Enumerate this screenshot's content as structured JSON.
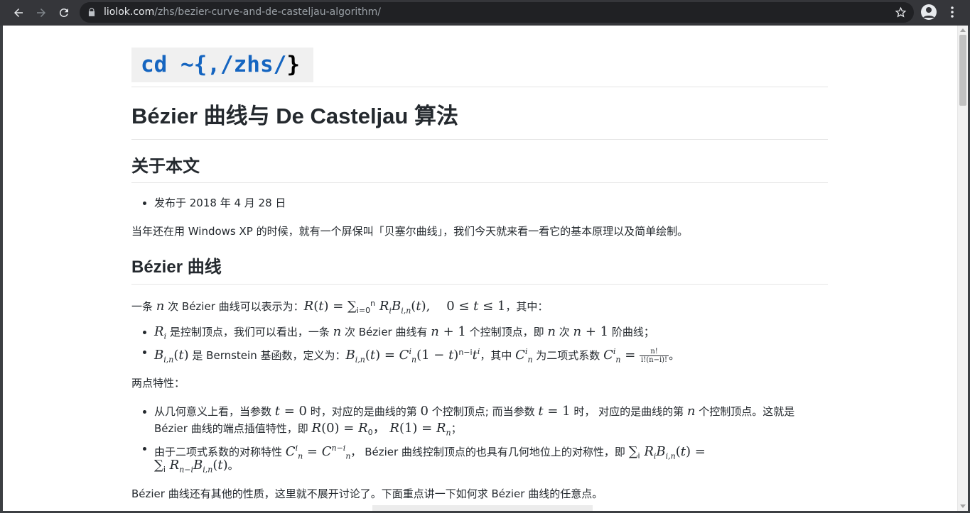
{
  "browser": {
    "url_host": "liolok.com",
    "url_path": "/zhs/bezier-curve-and-de-casteljau-algorithm/",
    "icons": [
      "back-arrow-icon",
      "forward-arrow-icon",
      "reload-icon",
      "lock-icon",
      "star-icon",
      "profile-icon",
      "menu-dots-icon"
    ]
  },
  "site": {
    "logo_cd": "cd ~{,",
    "logo_path": "/zhs/",
    "logo_end": "}"
  },
  "article": {
    "title": "Bézier 曲线与 De Casteljau 算法",
    "about_heading": "关于本文",
    "published": "发布于 2018 年 4 月 28 日",
    "intro": "当年还在用 Windows XP 的时候，就有一个屏保叫「贝塞尔曲线」，我们今天就来看一看它的基本原理以及简单绘制。",
    "bezier_heading": "Bézier 曲线",
    "def_prefix": "一条 ",
    "def_mid": " 次 Bézier 曲线可以表示为：",
    "def_suffix": "，其中：",
    "li1_a": " 是控制顶点，我们可以看出，一条 ",
    "li1_b": " 次 Bézier 曲线有 ",
    "li1_c": " 个控制顶点，即 ",
    "li1_d": " 次 ",
    "li1_e": " 阶曲线；",
    "li2_a": " 是 Bernstein 基函数，定义为：",
    "li2_b": "，其中 ",
    "li2_c": " 为二项式系数 ",
    "li2_end": "。",
    "two_points": "两点特性：",
    "li3_a": "从几何意义上看，当参数 ",
    "li3_b": " 时，对应的是曲线的第 ",
    "li3_c": " 个控制顶点; 而当参数 ",
    "li3_d": " 时， 对应的是曲线的第 ",
    "li3_e": " 个控制顶点。这就是",
    "li3_f": "Bézier 曲线的端点插值特性，即 ",
    "li3_g": "；",
    "li4_a": "由于二项式系数的对称特性 ",
    "li4_b": "， Bézier 曲线控制顶点的也具有几何地位上的对称性，即 ",
    "li4_end": "。",
    "closing": "Bézier 曲线还有其他的性质，这里就不展开讨论了。下面重点讲一下如何求 Bézier 曲线的任意点。"
  }
}
